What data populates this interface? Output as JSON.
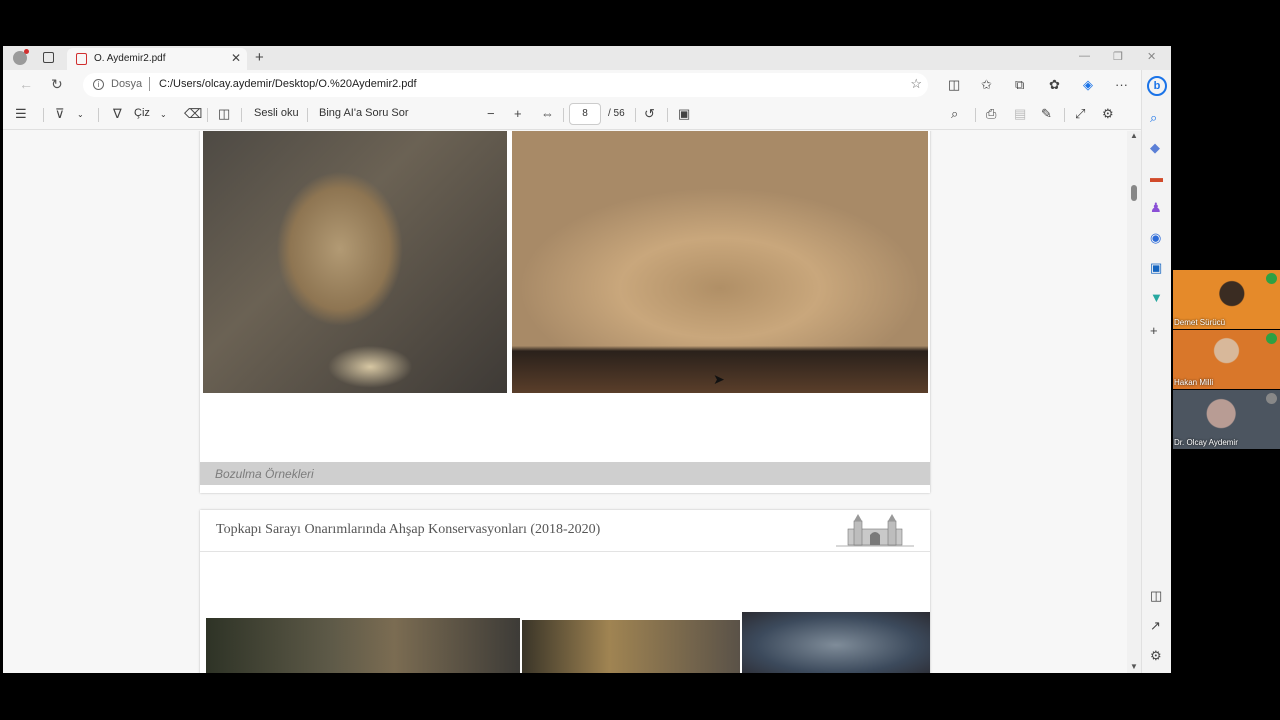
{
  "tab": {
    "title": "O. Aydemir2.pdf",
    "close": "✕",
    "new": "+"
  },
  "window": {
    "minimize": "—",
    "restore": "❐",
    "close": "✕"
  },
  "address": {
    "label": "Dosya",
    "url": "C:/Users/olcay.aydemir/Desktop/O.%20Aydemir2.pdf"
  },
  "pdf_toolbar": {
    "draw": "Çiz",
    "read_aloud": "Sesli oku",
    "ask_bing": "Bing AI'a Soru Sor",
    "page_current": "8",
    "page_total": "/ 56"
  },
  "document": {
    "caption": "Bozulma Örnekleri",
    "slide_title": "Topkapı Sarayı Onarımlarında Ahşap Konservasyonları (2018-2020)"
  },
  "participants": [
    {
      "name": "Demet Sürücü",
      "mic": "on"
    },
    {
      "name": "Hakan Milli",
      "mic": "on"
    },
    {
      "name": "Dr. Olcay Aydemir",
      "mic": "off"
    }
  ],
  "colors": {
    "accent": "#1a73e8",
    "pdf_red": "#d12f2f",
    "caption_bar": "#cfcfcf"
  }
}
